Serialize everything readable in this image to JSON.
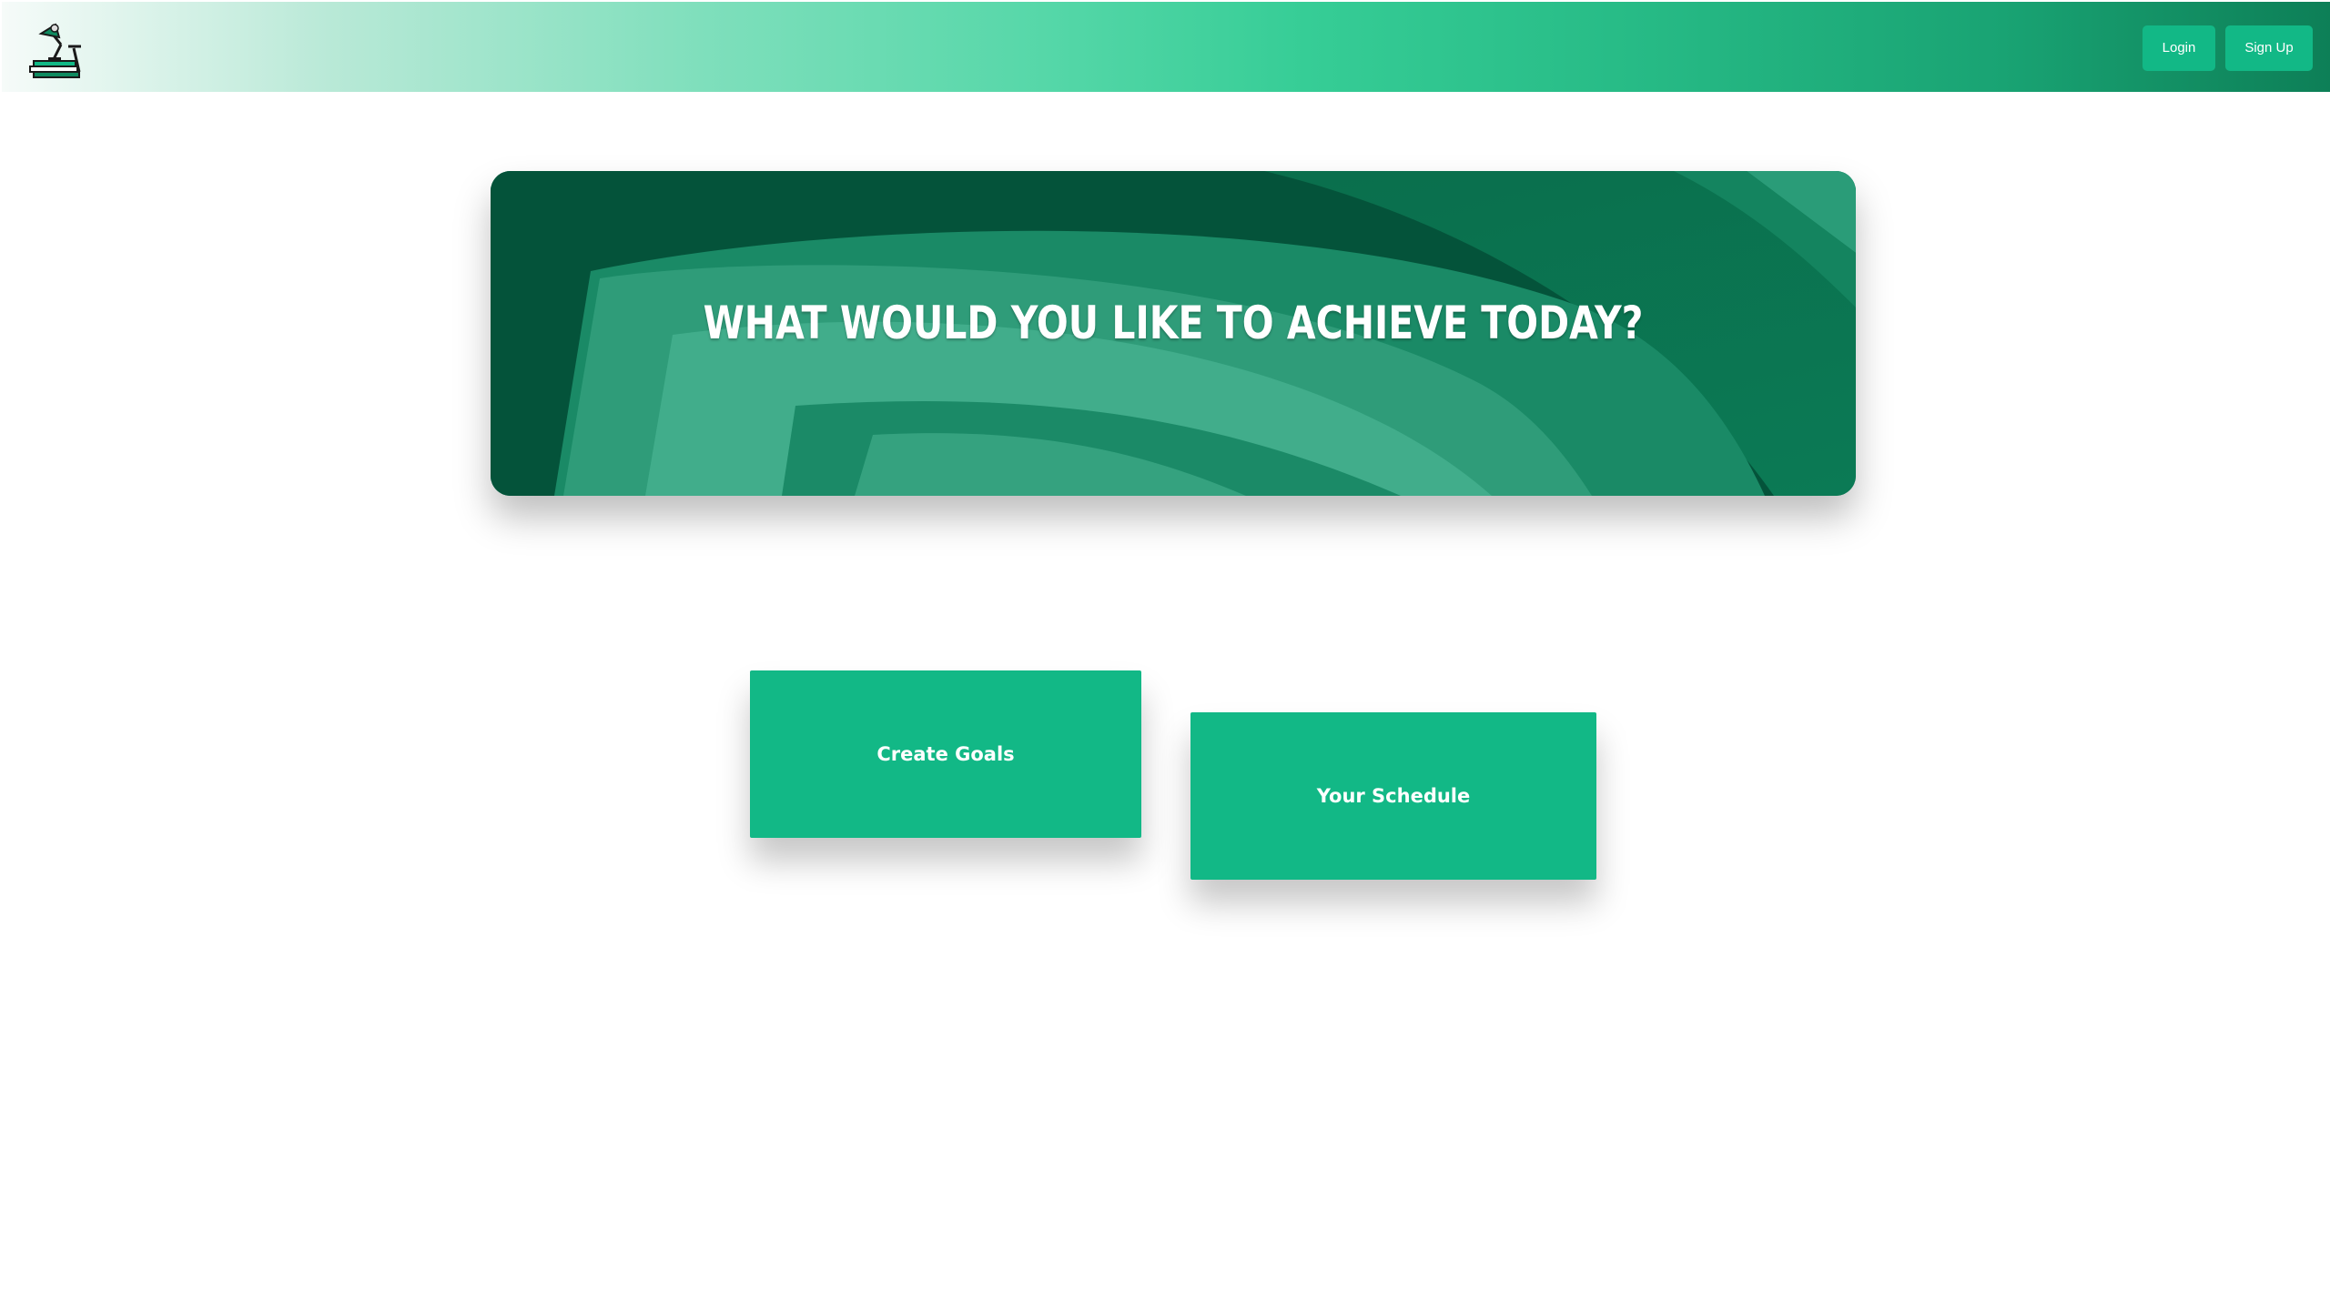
{
  "navbar": {
    "logo": "desk-lamp-books-logo",
    "login_label": "Login",
    "signup_label": "Sign Up"
  },
  "hero": {
    "title": "WHAT WOULD YOU LIKE TO ACHIEVE TODAY?"
  },
  "actions": {
    "create_goals_label": "Create Goals",
    "schedule_label": "Your Schedule"
  },
  "colors": {
    "accent": "#12b886",
    "hero_dark": "#07714f",
    "hero_light": "#3fb08a"
  }
}
